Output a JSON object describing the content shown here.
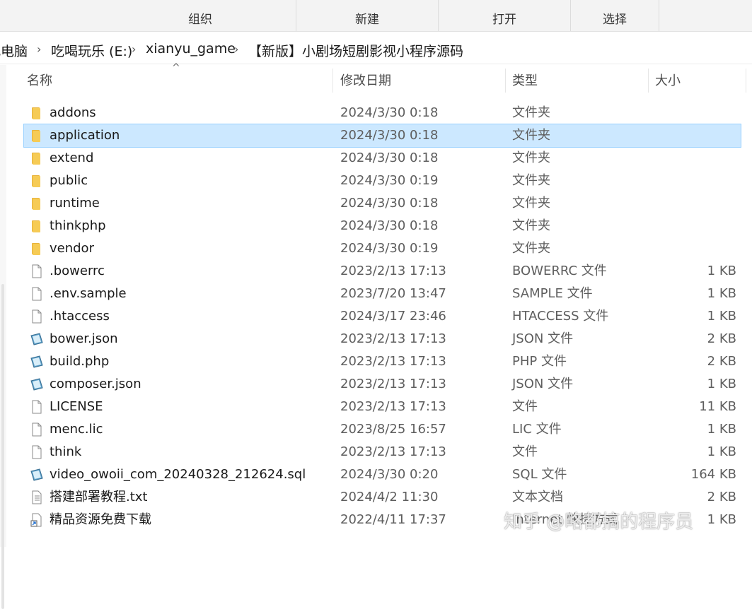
{
  "ribbon": {
    "groups": [
      "组织",
      "新建",
      "打开",
      "选择"
    ]
  },
  "breadcrumb": {
    "items": [
      "此电脑",
      "吃喝玩乐 (E:)",
      "xianyu_game",
      "【新版】小剧场短剧影视小程序源码"
    ],
    "separator": "›"
  },
  "columns": {
    "name": "名称",
    "date": "修改日期",
    "type": "类型",
    "size": "大小",
    "sort_indicator": "^"
  },
  "files": [
    {
      "name": "addons",
      "date": "2024/3/30 0:18",
      "type": "文件夹",
      "size": "",
      "icon": "folder-icon"
    },
    {
      "name": "application",
      "date": "2024/3/30 0:18",
      "type": "文件夹",
      "size": "",
      "icon": "folder-icon"
    },
    {
      "name": "extend",
      "date": "2024/3/30 0:18",
      "type": "文件夹",
      "size": "",
      "icon": "folder-icon"
    },
    {
      "name": "public",
      "date": "2024/3/30 0:19",
      "type": "文件夹",
      "size": "",
      "icon": "folder-icon"
    },
    {
      "name": "runtime",
      "date": "2024/3/30 0:18",
      "type": "文件夹",
      "size": "",
      "icon": "folder-icon"
    },
    {
      "name": "thinkphp",
      "date": "2024/3/30 0:18",
      "type": "文件夹",
      "size": "",
      "icon": "folder-icon"
    },
    {
      "name": "vendor",
      "date": "2024/3/30 0:19",
      "type": "文件夹",
      "size": "",
      "icon": "folder-icon"
    },
    {
      "name": ".bowerrc",
      "date": "2023/2/13 17:13",
      "type": "BOWERRC 文件",
      "size": "1 KB",
      "icon": "file-icon"
    },
    {
      "name": ".env.sample",
      "date": "2023/7/20 13:47",
      "type": "SAMPLE 文件",
      "size": "1 KB",
      "icon": "file-icon"
    },
    {
      "name": ".htaccess",
      "date": "2024/3/17 23:46",
      "type": "HTACCESS 文件",
      "size": "1 KB",
      "icon": "file-icon"
    },
    {
      "name": "bower.json",
      "date": "2023/2/13 17:13",
      "type": "JSON 文件",
      "size": "2 KB",
      "icon": "code-file-icon"
    },
    {
      "name": "build.php",
      "date": "2023/2/13 17:13",
      "type": "PHP 文件",
      "size": "2 KB",
      "icon": "code-file-icon"
    },
    {
      "name": "composer.json",
      "date": "2023/2/13 17:13",
      "type": "JSON 文件",
      "size": "1 KB",
      "icon": "code-file-icon"
    },
    {
      "name": "LICENSE",
      "date": "2023/2/13 17:13",
      "type": "文件",
      "size": "11 KB",
      "icon": "file-icon"
    },
    {
      "name": "menc.lic",
      "date": "2023/8/25 16:57",
      "type": "LIC 文件",
      "size": "1 KB",
      "icon": "file-icon"
    },
    {
      "name": "think",
      "date": "2023/2/13 17:13",
      "type": "文件",
      "size": "1 KB",
      "icon": "file-icon"
    },
    {
      "name": "video_owoii_com_20240328_212624.sql",
      "date": "2024/3/30 0:20",
      "type": "SQL 文件",
      "size": "164 KB",
      "icon": "code-file-icon"
    },
    {
      "name": "搭建部署教程.txt",
      "date": "2024/4/2 11:30",
      "type": "文本文档",
      "size": "2 KB",
      "icon": "text-file-icon"
    },
    {
      "name": "精品资源免费下载",
      "date": "2022/4/11 17:37",
      "type": "Internet 快捷方式",
      "size": "1 KB",
      "icon": "shortcut-icon"
    }
  ],
  "selected_index": 1,
  "watermark": "知乎 @略都搞的程序员",
  "colors": {
    "selection_bg": "#cce8ff",
    "selection_border": "#99d1ff",
    "folder": "#f5c542"
  }
}
